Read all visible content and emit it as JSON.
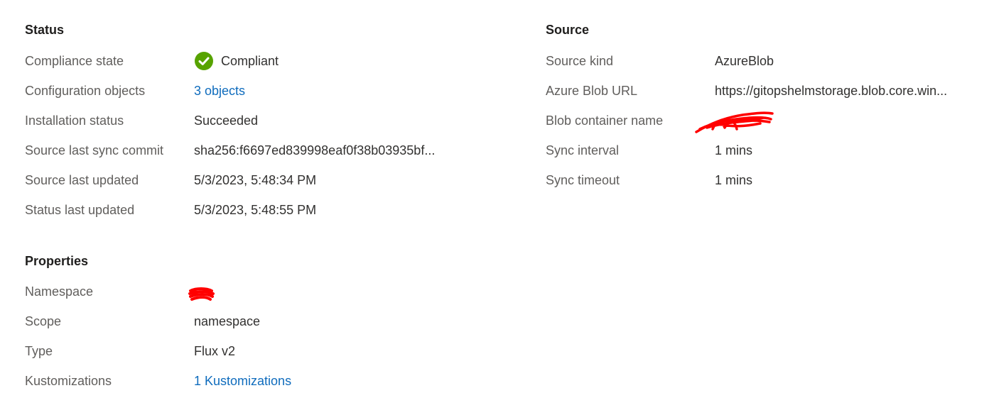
{
  "status": {
    "title": "Status",
    "rows": [
      {
        "label": "Compliance state",
        "value": "Compliant"
      },
      {
        "label": "Configuration objects",
        "value": "3 objects"
      },
      {
        "label": "Installation status",
        "value": "Succeeded"
      },
      {
        "label": "Source last sync commit",
        "value": "sha256:f6697ed839998eaf0f38b03935bf..."
      },
      {
        "label": "Source last updated",
        "value": "5/3/2023, 5:48:34 PM"
      },
      {
        "label": "Status last updated",
        "value": "5/3/2023, 5:48:55 PM"
      }
    ],
    "compliant_color": "#57a300"
  },
  "source": {
    "title": "Source",
    "rows": [
      {
        "label": "Source kind",
        "value": "AzureBlob"
      },
      {
        "label": "Azure Blob URL",
        "value": "https://gitopshelmstorage.blob.core.win..."
      },
      {
        "label": "Blob container name",
        "value": ""
      },
      {
        "label": "Sync interval",
        "value": "1 mins"
      },
      {
        "label": "Sync timeout",
        "value": "1 mins"
      }
    ]
  },
  "properties": {
    "title": "Properties",
    "rows": [
      {
        "label": "Namespace",
        "value": ""
      },
      {
        "label": "Scope",
        "value": "namespace"
      },
      {
        "label": "Type",
        "value": "Flux v2"
      },
      {
        "label": "Kustomizations",
        "value": "1 Kustomizations"
      }
    ]
  },
  "colors": {
    "link": "#0f6cbd",
    "redaction": "#ff0000"
  },
  "icons": {
    "compliance": "checkmark-circle-icon"
  }
}
